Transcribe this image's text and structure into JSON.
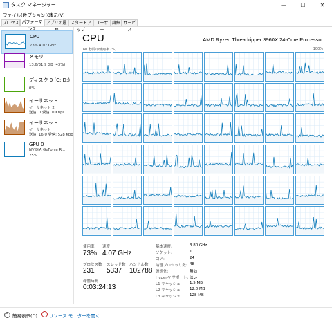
{
  "window": {
    "title": "タスク マネージャー"
  },
  "window_buttons": {
    "minimize": "—",
    "maximize": "☐",
    "close": "✕"
  },
  "menu": [
    "ファイル(F)",
    "オプション(O)",
    "表示(V)"
  ],
  "tabs": [
    {
      "label": "プロセス",
      "active": false
    },
    {
      "label": "パフォーマンス",
      "active": true
    },
    {
      "label": "アプリの履歴",
      "active": false
    },
    {
      "label": "スタートアップ",
      "active": false
    },
    {
      "label": "ユーザー",
      "active": false
    },
    {
      "label": "詳細",
      "active": false
    },
    {
      "label": "サービス",
      "active": false
    }
  ],
  "sidebar": {
    "items": [
      {
        "title": "CPU",
        "line1": "73%  4.07 GHz",
        "line2": "",
        "color": "#117dbb"
      },
      {
        "title": "メモリ",
        "line1": "13.6/31.9 GB (43%)",
        "line2": "",
        "color": "#8b12ae"
      },
      {
        "title": "ディスク 0 (C: D:)",
        "line1": "0%",
        "line2": "",
        "color": "#4da60c"
      },
      {
        "title": "イーサネット",
        "line1": "イーサネット 2",
        "line2": "送信: 0 受信: 0 Kbps",
        "color": "#a74f01"
      },
      {
        "title": "イーサネット",
        "line1": "イーサネット",
        "line2": "送信: 16.0  受信: 528 Kbp",
        "color": "#a74f01"
      },
      {
        "title": "GPU 0",
        "line1": "NVIDIA GeForce R...",
        "line2": "25%",
        "color": "#117dbb"
      }
    ]
  },
  "main": {
    "title": "CPU",
    "model": "AMD Ryzen Threadripper 3960X 24-Core Processor",
    "axis_left": "60 秒間の使用率 (%)",
    "axis_right": "100%",
    "core_count": 48,
    "accent_color": "#117dbb",
    "grid_border_color": "#4a9fd8"
  },
  "stats": {
    "usage_label": "使用率",
    "usage": "73%",
    "speed_label": "速度",
    "speed": "4.07 GHz",
    "process_label": "プロセス数",
    "process": "231",
    "thread_label": "スレッド数",
    "thread": "5337",
    "handle_label": "ハンドル数",
    "handle": "102788",
    "uptime_label": "稼働時間",
    "uptime": "0:03:24:13"
  },
  "specs": [
    {
      "k": "基本速度:",
      "v": "3.80 GHz"
    },
    {
      "k": "ソケット:",
      "v": "1"
    },
    {
      "k": "コア:",
      "v": "24"
    },
    {
      "k": "論理プロセッサ数:",
      "v": "48"
    },
    {
      "k": "仮想化:",
      "v": "無効"
    },
    {
      "k": "Hyper-V サポート:",
      "v": "はい"
    },
    {
      "k": "L1 キャッシュ:",
      "v": "1.5 MB"
    },
    {
      "k": "L2 キャッシュ:",
      "v": "12.0 MB"
    },
    {
      "k": "L3 キャッシュ:",
      "v": "128 MB"
    }
  ],
  "footer": {
    "fewer_details": "簡易表示(D)",
    "resource_monitor": "リソース モニターを開く"
  }
}
